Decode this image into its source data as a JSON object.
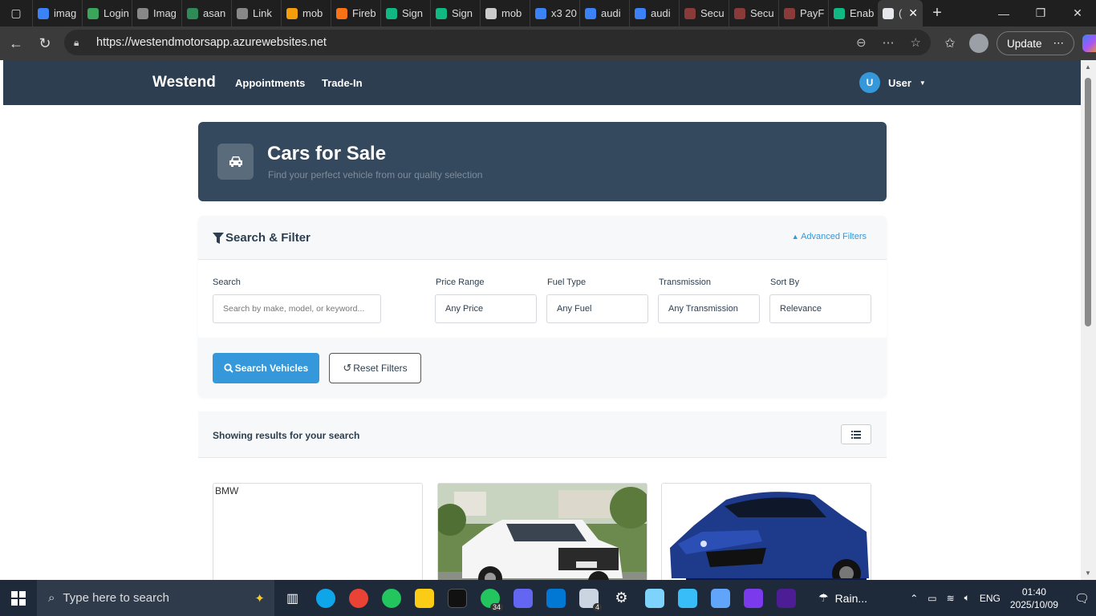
{
  "browser": {
    "tabs": [
      {
        "label": "imag",
        "color": "#3b82f6"
      },
      {
        "label": "Login",
        "color": "#3ba55c"
      },
      {
        "label": "Imag",
        "color": "#888888"
      },
      {
        "label": "asan",
        "color": "#2e8b57"
      },
      {
        "label": "Link",
        "color": "#888888"
      },
      {
        "label": "mob",
        "color": "#f59e0b"
      },
      {
        "label": "Fireb",
        "color": "#f97316"
      },
      {
        "label": "Sign",
        "color": "#10b981"
      },
      {
        "label": "Sign",
        "color": "#10b981"
      },
      {
        "label": "mob",
        "color": "#cccccc"
      },
      {
        "label": "x3 20",
        "color": "#3b82f6"
      },
      {
        "label": "audi",
        "color": "#3b82f6"
      },
      {
        "label": "audi",
        "color": "#3b82f6"
      },
      {
        "label": "Secu",
        "color": "#8b3a3a"
      },
      {
        "label": "Secu",
        "color": "#8b3a3a"
      },
      {
        "label": "PayF",
        "color": "#8b3a3a"
      },
      {
        "label": "Enab",
        "color": "#10b981"
      }
    ],
    "active_tab_label": "(",
    "url": "https://westendmotorsapp.azurewebsites.net",
    "update_label": "Update"
  },
  "site": {
    "brand": "Westend",
    "nav": [
      {
        "label": "Appointments"
      },
      {
        "label": "Trade-In"
      }
    ],
    "user_initial": "U",
    "user_label": "User"
  },
  "hero": {
    "title": "Cars for Sale",
    "subtitle": "Find your perfect vehicle from our quality selection"
  },
  "filter": {
    "title": "Search & Filter",
    "advanced_label": "Advanced Filters",
    "search_label": "Search",
    "search_placeholder": "Search by make, model, or keyword...",
    "price_label": "Price Range",
    "price_value": "Any Price",
    "fuel_label": "Fuel Type",
    "fuel_value": "Any Fuel",
    "transmission_label": "Transmission",
    "transmission_value": "Any Transmission",
    "sort_label": "Sort By",
    "sort_value": "Relevance",
    "search_button": "Search Vehicles",
    "reset_button": "Reset Filters"
  },
  "results": {
    "heading": "Showing results for your search",
    "cards": [
      {
        "alt": "BMW"
      },
      {
        "alt": ""
      },
      {
        "alt": ""
      }
    ]
  },
  "taskbar": {
    "search_placeholder": "Type here to search",
    "whatsapp_badge": "34",
    "mail_badge": "4",
    "weather": "Rain...",
    "language": "ENG",
    "time": "01:40",
    "date": "2025/10/09"
  }
}
